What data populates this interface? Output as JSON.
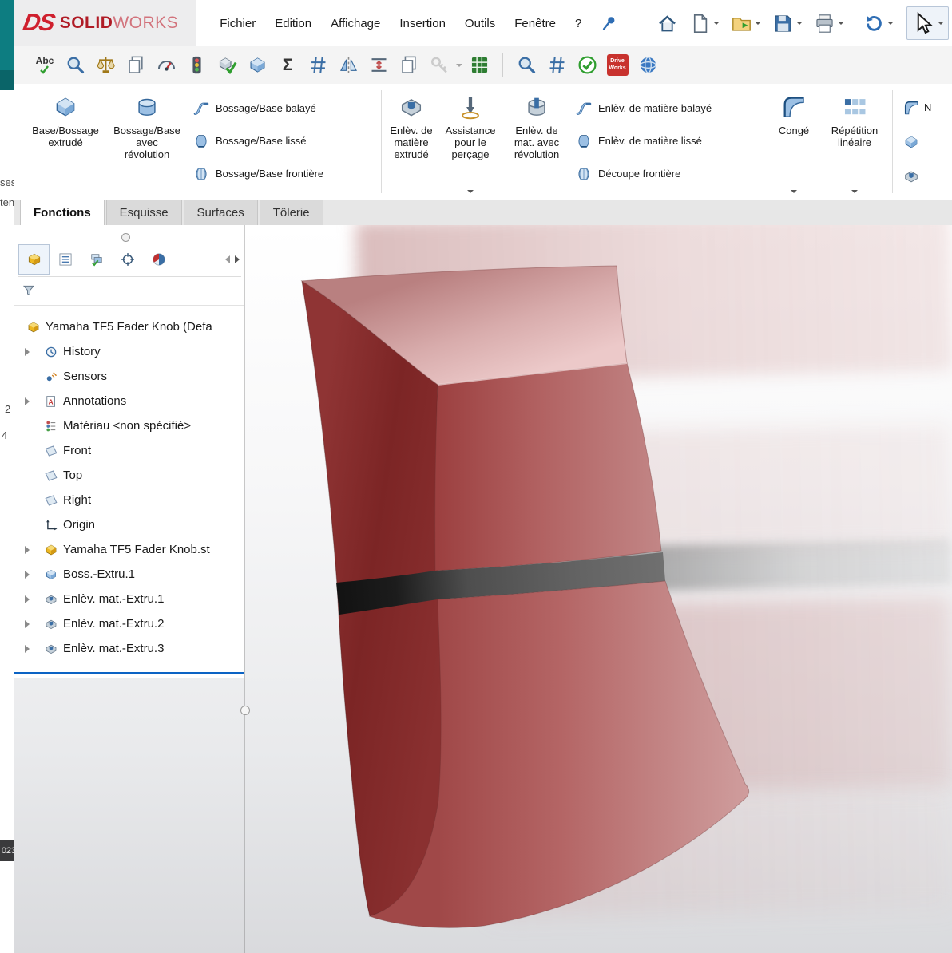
{
  "brand": {
    "ds": "DS",
    "solid": "SOLID",
    "works": "WORKS"
  },
  "menubar": {
    "items": [
      "Fichier",
      "Edition",
      "Affichage",
      "Insertion",
      "Outils",
      "Fenêtre",
      "?"
    ]
  },
  "toolbar2": {
    "spell": "Abc",
    "sigma": "Σ",
    "driveworks": "Drive\nWorks"
  },
  "ribbon": {
    "boss_extrude": "Base/Bossage\nextrudé",
    "boss_revolve": "Bossage/Base\navec\nrévolution",
    "swept_boss": "Bossage/Base balayé",
    "lofted_boss": "Bossage/Base lissé",
    "boundary_boss": "Bossage/Base frontière",
    "cut_extrude": "Enlèv. de\nmatière\nextrudé",
    "hole_wizard": "Assistance\npour le\nperçage",
    "cut_revolve": "Enlèv. de\nmat. avec\nrévolution",
    "swept_cut": "Enlèv. de matière balayé",
    "lofted_cut": "Enlèv. de matière lissé",
    "boundary_cut": "Découpe frontière",
    "fillet": "Congé",
    "linear_pattern": "Répétition\nlinéaire",
    "partial_right": "N"
  },
  "tabs": {
    "items": [
      "Fonctions",
      "Esquisse",
      "Surfaces",
      "Tôlerie"
    ],
    "active": "Fonctions"
  },
  "tree": {
    "items": [
      {
        "label": "Yamaha TF5 Fader Knob  (Defa"
      },
      {
        "label": "History"
      },
      {
        "label": "Sensors"
      },
      {
        "label": "Annotations"
      },
      {
        "label": "Matériau <non spécifié>"
      },
      {
        "label": "Front"
      },
      {
        "label": "Top"
      },
      {
        "label": "Right"
      },
      {
        "label": "Origin"
      },
      {
        "label": "Yamaha TF5 Fader Knob.st"
      },
      {
        "label": "Boss.-Extru.1"
      },
      {
        "label": "Enlèv. mat.-Extru.1"
      },
      {
        "label": "Enlèv. mat.-Extru.2"
      },
      {
        "label": "Enlèv. mat.-Extru.3"
      }
    ]
  },
  "edge": {
    "frag1": "ses",
    "frag2": "ten",
    "frag3": "2",
    "frag4": "4",
    "clock": "023"
  },
  "colors": {
    "accent_blue": "#0b63c4",
    "teal": "#0d7d81",
    "logo_red": "#cf202e",
    "knob_red": "#a44a4a",
    "knob_dark": "#7c2525",
    "band_gray": "#5a5a5a"
  }
}
